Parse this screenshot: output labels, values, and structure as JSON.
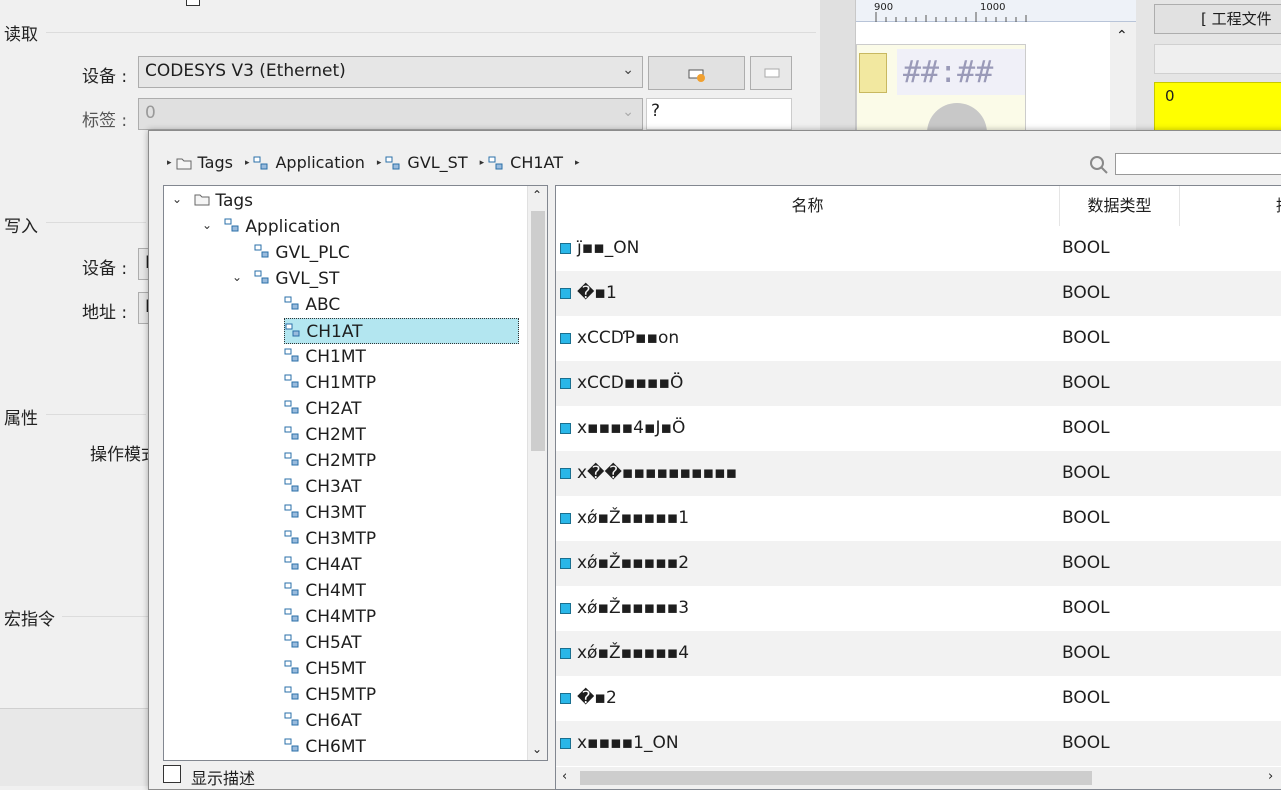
{
  "read_section": {
    "title": "读取",
    "device_label": "设备 :",
    "device_value": "CODESYS V3 (Ethernet)",
    "tag_label": "标签 :",
    "tag_value": "0",
    "tag_extra": "?"
  },
  "write_section": {
    "title": "写入",
    "device_label": "设备 :",
    "device_value": "I",
    "address_label": "地址 :",
    "address_value": "N"
  },
  "properties_section": {
    "title": "属性",
    "operation_label": "操作模式"
  },
  "macro_section": {
    "title": "宏指令"
  },
  "right_panel": {
    "ruler_900": "900",
    "ruler_1000": "1000",
    "clock_text": "##:##",
    "project_file_button": "[ 工程文件",
    "yellow_value": "0"
  },
  "popup": {
    "breadcrumb": [
      "Tags",
      "Application",
      "GVL_ST",
      "CH1AT"
    ],
    "search_placeholder": "",
    "show_description_label": "显示描述",
    "tree": {
      "root": "Tags",
      "application": "Application",
      "gvl_plc": "GVL_PLC",
      "gvl_st": "GVL_ST",
      "children": [
        "ABC",
        "CH1AT",
        "CH1MT",
        "CH1MTP",
        "CH2AT",
        "CH2MT",
        "CH2MTP",
        "CH3AT",
        "CH3MT",
        "CH3MTP",
        "CH4AT",
        "CH4MT",
        "CH4MTP",
        "CH5AT",
        "CH5MT",
        "CH5MTP",
        "CH6AT",
        "CH6MT"
      ],
      "selected": "CH1AT"
    },
    "grid": {
      "headers": {
        "name": "名称",
        "type": "数据类型",
        "desc": "描述"
      },
      "rows": [
        {
          "name": "j̈▪▪_ON",
          "type": "BOOL"
        },
        {
          "name": "�▪1",
          "type": "BOOL"
        },
        {
          "name": "xCCDƤ▪▪on",
          "type": "BOOL"
        },
        {
          "name": "xCCD▪▪▪▪Ö",
          "type": "BOOL"
        },
        {
          "name": "x▪▪▪▪4▪J▪Ö",
          "type": "BOOL"
        },
        {
          "name": "x��▪▪▪▪▪▪▪▪▪▪",
          "type": "BOOL"
        },
        {
          "name": "xǿ▪Ž▪▪▪▪▪1",
          "type": "BOOL"
        },
        {
          "name": "xǿ▪Ž▪▪▪▪▪2",
          "type": "BOOL"
        },
        {
          "name": "xǿ▪Ž▪▪▪▪▪3",
          "type": "BOOL"
        },
        {
          "name": "xǿ▪Ž▪▪▪▪▪4",
          "type": "BOOL"
        },
        {
          "name": "�▪2",
          "type": "BOOL"
        },
        {
          "name": "x▪▪▪▪1_ON",
          "type": "BOOL"
        }
      ]
    }
  },
  "colors": {
    "selected_bg": "#b3e6f0",
    "tag_icon": "#29b6e8",
    "yellow": "#ffff00"
  }
}
